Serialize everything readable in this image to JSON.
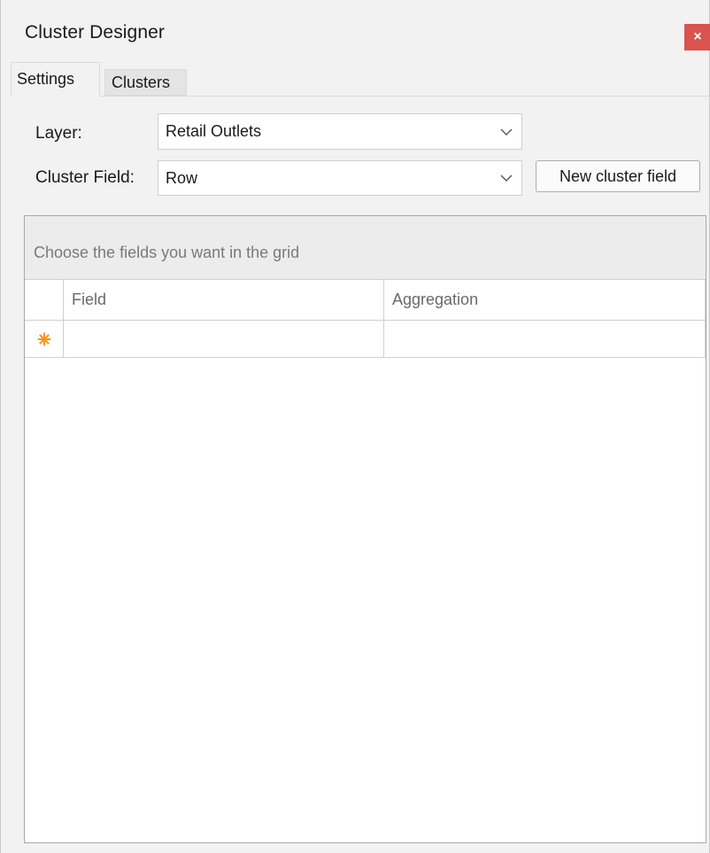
{
  "window": {
    "title": "Cluster Designer",
    "close_label": "×"
  },
  "tabs": [
    {
      "label": "Settings",
      "active": true
    },
    {
      "label": "Clusters",
      "active": false
    }
  ],
  "settings": {
    "layer_label": "Layer:",
    "layer_value": "Retail Outlets",
    "cluster_field_label": "Cluster Field:",
    "cluster_field_value": "Row",
    "new_cluster_field_label": "New cluster field"
  },
  "grid": {
    "group_panel_text": "Choose the fields you want in the grid",
    "columns": [
      "Field",
      "Aggregation"
    ],
    "rows": [],
    "new_row_icon": "new-row-star-icon"
  },
  "colors": {
    "close_button": "#d9534f",
    "new_row_star": "#f7941d",
    "window_background": "#f2f2f2"
  }
}
